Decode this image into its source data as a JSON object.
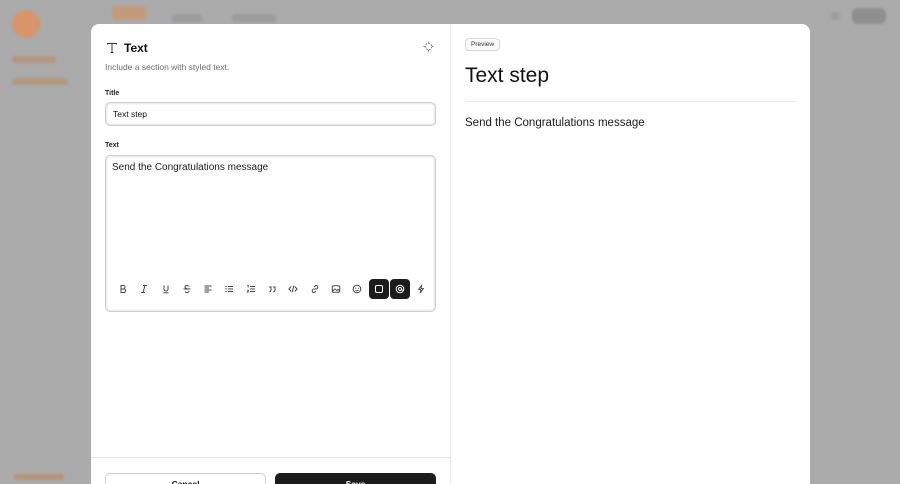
{
  "editor": {
    "title": "Text",
    "subtitle": "Include a section with styled text.",
    "title_field_label": "Title",
    "title_value": "Text step",
    "text_field_label": "Text",
    "text_value": "Send the Congratulations message",
    "toolbar": [
      {
        "icon": "bold-icon"
      },
      {
        "icon": "italic-icon"
      },
      {
        "icon": "underline-icon"
      },
      {
        "icon": "strikethrough-icon"
      },
      {
        "icon": "align-left-icon"
      },
      {
        "icon": "bullet-list-icon"
      },
      {
        "icon": "numbered-list-icon"
      },
      {
        "icon": "quote-icon"
      },
      {
        "icon": "code-icon"
      },
      {
        "icon": "link-icon"
      },
      {
        "icon": "image-icon"
      },
      {
        "icon": "emoji-icon"
      },
      {
        "icon": "square-icon",
        "active": true
      },
      {
        "icon": "at-sign-icon",
        "active": true
      },
      {
        "icon": "lightning-icon"
      }
    ]
  },
  "footer": {
    "cancel_label": "Cancel",
    "save_label": "Save"
  },
  "preview": {
    "badge": "Preview",
    "title": "Text step",
    "text": "Send the Congratulations message"
  },
  "colors": {
    "overlay": "#a9a9a9",
    "active_button": "#1c1c1c",
    "brand_background": "#d9946a"
  }
}
